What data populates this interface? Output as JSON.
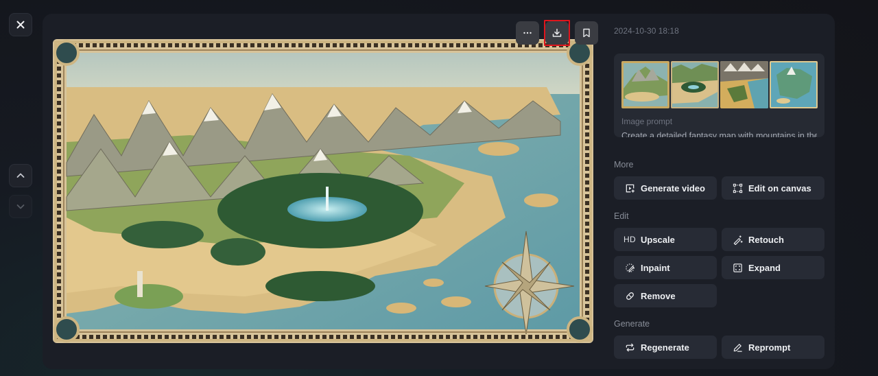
{
  "nav": {
    "close_icon": "close-icon",
    "prev_icon": "chevron-up-icon",
    "next_icon": "chevron-down-icon"
  },
  "image_toolbar": {
    "more_icon": "more-horizontal-icon",
    "download_icon": "download-icon",
    "bookmark_icon": "bookmark-icon"
  },
  "details": {
    "timestamp": "2024-10-30 18:18",
    "prompt_label": "Image prompt",
    "prompt_text": "Create a detailed fantasy map with mountains in the north, a forest with a lake in the center, and an ocean with islands in the east",
    "thumbnails": [
      {
        "name": "variant-1",
        "palette": "mountain-volcano"
      },
      {
        "name": "variant-2",
        "palette": "forest-lake"
      },
      {
        "name": "variant-3",
        "palette": "desert-coast"
      },
      {
        "name": "variant-4",
        "palette": "blue-islands"
      }
    ]
  },
  "sections": {
    "more": {
      "label": "More",
      "buttons": [
        {
          "label": "Generate video",
          "icon": "video-plus-icon"
        },
        {
          "label": "Edit on canvas",
          "icon": "canvas-nodes-icon"
        }
      ]
    },
    "edit": {
      "label": "Edit",
      "buttons": [
        {
          "label": "Upscale",
          "icon_text": "HD"
        },
        {
          "label": "Retouch",
          "icon": "magic-wand-icon"
        },
        {
          "label": "Inpaint",
          "icon": "brush-circle-icon"
        },
        {
          "label": "Expand",
          "icon": "expand-frame-icon"
        },
        {
          "label": "Remove",
          "icon": "eraser-icon"
        }
      ]
    },
    "generate": {
      "label": "Generate",
      "buttons": [
        {
          "label": "Regenerate",
          "icon": "repeat-icon"
        },
        {
          "label": "Reprompt",
          "icon": "pencil-icon"
        }
      ]
    }
  },
  "colors": {
    "highlight": "#e0151c",
    "panel": "#1b1e26",
    "button": "#272b35"
  }
}
